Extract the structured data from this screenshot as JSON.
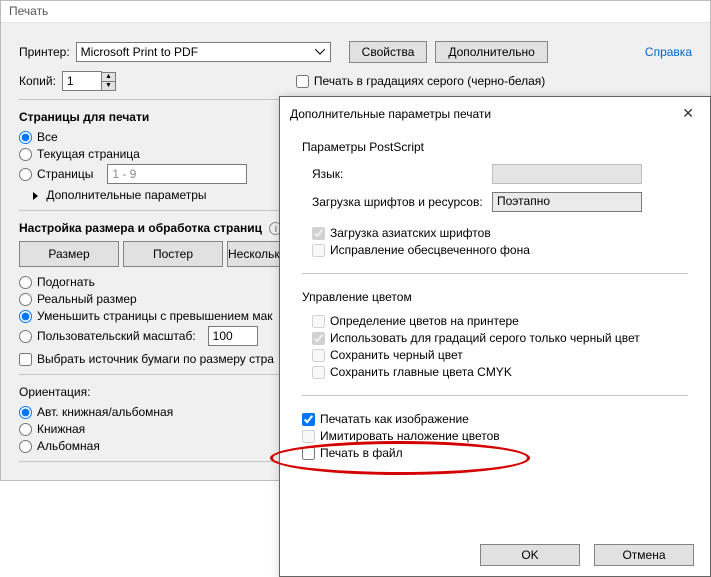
{
  "window": {
    "title": "Печать"
  },
  "printer": {
    "label": "Принтер:",
    "value": "Microsoft Print to PDF",
    "properties_btn": "Свойства",
    "advanced_btn": "Дополнительно",
    "help_link": "Справка"
  },
  "copies": {
    "label": "Копий:",
    "value": "1"
  },
  "grayscale_cb": "Печать в градациях серого (черно-белая)",
  "pages": {
    "title": "Страницы для печати",
    "all": "Все",
    "current": "Текущая страница",
    "range": "Страницы",
    "range_value": "1 - 9",
    "more": "Дополнительные параметры"
  },
  "size": {
    "title": "Настройка размера и обработка страниц",
    "btn_size": "Размер",
    "btn_poster": "Постер",
    "btn_multi": "Несколько",
    "fit": "Подогнать",
    "actual": "Реальный размер",
    "shrink": "Уменьшить страницы с превышением мак",
    "custom": "Пользовательский масштаб:",
    "custom_value": "100",
    "paper_source_cb": "Выбрать источник бумаги по размеру стра"
  },
  "orient": {
    "title": "Ориентация:",
    "auto": "Авт. книжная/альбомная",
    "portrait": "Книжная",
    "landscape": "Альбомная"
  },
  "dlg": {
    "title": "Дополнительные параметры печати",
    "ps": {
      "title": "Параметры PostScript",
      "lang": "Язык:",
      "fontload": "Загрузка шрифтов и ресурсов:",
      "fontload_val": "Поэтапно",
      "asian_cb": "Загрузка азиатских шрифтов",
      "bg_cb": "Исправление обесцвеченного фона"
    },
    "color": {
      "title": "Управление цветом",
      "detect_cb": "Определение цветов на принтере",
      "black_cb": "Использовать для градаций серого только черный цвет",
      "preserveK_cb": "Сохранить черный цвет",
      "cmyk_cb": "Сохранить главные цвета CMYK"
    },
    "print_image_cb": "Печатать как изображение",
    "overprint_cb": "Имитировать наложение цветов",
    "to_file_cb": "Печать в файл",
    "ok": "OK",
    "cancel": "Отмена"
  }
}
